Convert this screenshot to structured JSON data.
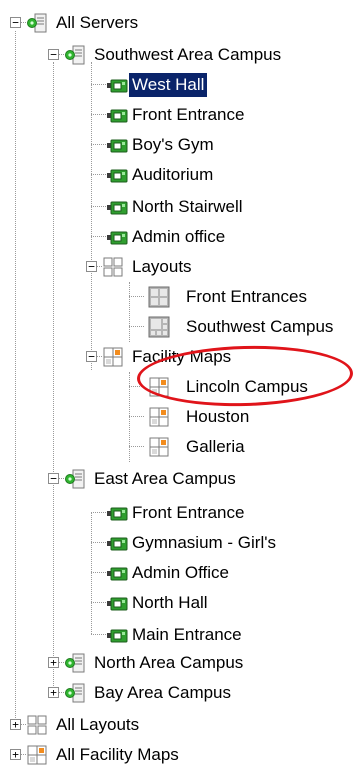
{
  "tree": {
    "all_servers": "All Servers",
    "southwest": {
      "label": "Southwest Area Campus",
      "cameras": [
        "West Hall",
        "Front Entrance",
        "Boy's Gym",
        "Auditorium",
        "North Stairwell",
        "Admin office"
      ],
      "layouts": {
        "label": "Layouts",
        "items": [
          "Front Entrances",
          "Southwest Campus"
        ]
      },
      "facility_maps": {
        "label": "Facility Maps",
        "items": [
          "Lincoln Campus",
          "Houston",
          "Galleria"
        ]
      }
    },
    "east": {
      "label": "East Area Campus",
      "cameras": [
        "Front Entrance",
        "Gymnasium - Girl's",
        "Admin Office",
        "North Hall",
        "Main Entrance"
      ]
    },
    "north": {
      "label": "North Area Campus"
    },
    "bay": {
      "label": "Bay Area Campus"
    },
    "all_layouts": "All Layouts",
    "all_facility_maps": "All Facility Maps"
  },
  "colors": {
    "selection": "#0a246a",
    "annotation": "#e0141a",
    "server_green": "#2fb52f"
  },
  "selected": "West Hall"
}
